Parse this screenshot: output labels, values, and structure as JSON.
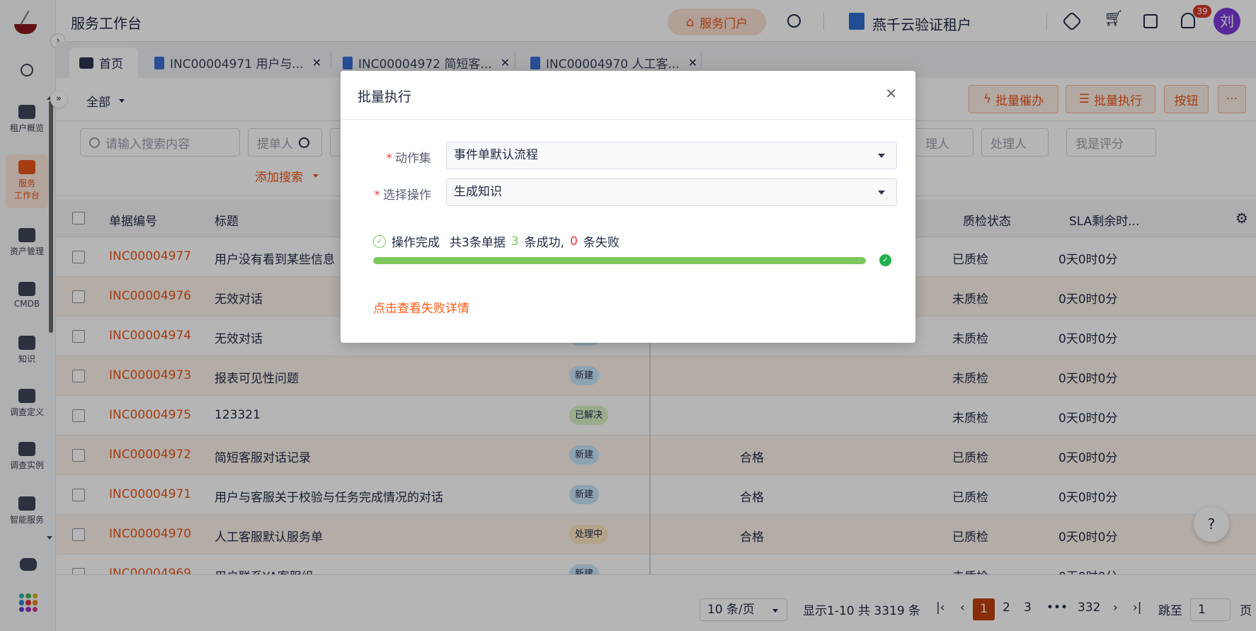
{
  "header": {
    "title": "服务工作台",
    "portal_label": "服务门户",
    "tenant": "燕千云验证租户",
    "notification_count": "39",
    "avatar": "刘"
  },
  "sidebar": {
    "items": [
      {
        "label": "租户概览",
        "icon": "monitor-icon"
      },
      {
        "label": "服务\n工作台",
        "icon": "briefcase-icon",
        "active": true
      },
      {
        "label": "资产管理",
        "icon": "asset-icon"
      },
      {
        "label": "CMDB",
        "icon": "sliders-icon"
      },
      {
        "label": "知识",
        "icon": "book-icon"
      },
      {
        "label": "调查定义",
        "icon": "document-icon"
      },
      {
        "label": "调查实例",
        "icon": "grid-icon"
      },
      {
        "label": "智能服务",
        "icon": "chat-help-icon"
      }
    ]
  },
  "tabs": [
    {
      "label": "首页"
    },
    {
      "label": "INC00004971 用户与..."
    },
    {
      "label": "INC00004972 简短客..."
    },
    {
      "label": "INC00004970 人工客..."
    }
  ],
  "toolbar": {
    "view": "全部",
    "urge": "批量催办",
    "batch_exec": "批量执行",
    "button": "按钮",
    "more": "···"
  },
  "filters": {
    "search_placeholder": "请输入搜索内容",
    "submitter": "提单人",
    "handler_partial": "理人",
    "handler": "处理人",
    "rating": "我是评分",
    "add_search": "添加搜索"
  },
  "table": {
    "headers": {
      "id": "单据编号",
      "title": "标题",
      "qc_status": "质检状态",
      "sla": "SLA剩余时..."
    },
    "rows": [
      {
        "id": "INC00004977",
        "title": "用户没有看到某些信息",
        "status": "",
        "quality": "",
        "qc": "已质检",
        "sla": "0天0时0分"
      },
      {
        "id": "INC00004976",
        "title": "无效对话",
        "status": "",
        "quality": "",
        "qc": "未质检",
        "sla": "0天0时0分"
      },
      {
        "id": "INC00004974",
        "title": "无效对话",
        "status": "",
        "quality": "",
        "qc": "未质检",
        "sla": "0天0时0分"
      },
      {
        "id": "INC00004973",
        "title": "报表可见性问题",
        "status": "新建",
        "quality": "",
        "qc": "未质检",
        "sla": "0天0时0分"
      },
      {
        "id": "INC00004975",
        "title": "123321",
        "status": "已解决",
        "quality": "",
        "qc": "未质检",
        "sla": "0天0时0分"
      },
      {
        "id": "INC00004972",
        "title": "简短客服对话记录",
        "status": "新建",
        "quality": "合格",
        "qc": "已质检",
        "sla": "0天0时0分"
      },
      {
        "id": "INC00004971",
        "title": "用户与客服关于校验与任务完成情况的对话",
        "status": "新建",
        "quality": "合格",
        "qc": "已质检",
        "sla": "0天0时0分"
      },
      {
        "id": "INC00004970",
        "title": "人工客服默认服务单",
        "status": "处理中",
        "quality": "合格",
        "qc": "已质检",
        "sla": "0天0时0分"
      },
      {
        "id": "INC00004969",
        "title": "用户联系YA客服组",
        "status": "新建",
        "quality": "",
        "qc": "未质检",
        "sla": "0天0时0分"
      }
    ]
  },
  "status_colors": {
    "新建": "#c9e6fb",
    "已解决": "#d9f2c4",
    "处理中": "#fde7c2"
  },
  "pagination": {
    "page_size": "10 条/页",
    "summary": "显示1-10 共 3319 条",
    "pages": [
      "1",
      "2",
      "3",
      "•••",
      "332"
    ],
    "current": "1",
    "jump_label": "跳至",
    "jump_value": "1",
    "page_suffix": "页"
  },
  "modal": {
    "title": "批量执行",
    "action_set_label": "动作集",
    "action_set_value": "事件单默认流程",
    "operation_label": "选择操作",
    "operation_value": "生成知识",
    "result_done": "操作完成",
    "result_total": "共3条单据",
    "success_count": "3",
    "success_text": "条成功,",
    "fail_count": "0",
    "fail_text": "条失败",
    "progress": 1.0,
    "fail_link": "点击查看失败详情"
  },
  "colors": {
    "accent": "#e9561b",
    "success": "#7cc85c",
    "fail": "#f23b3b"
  }
}
